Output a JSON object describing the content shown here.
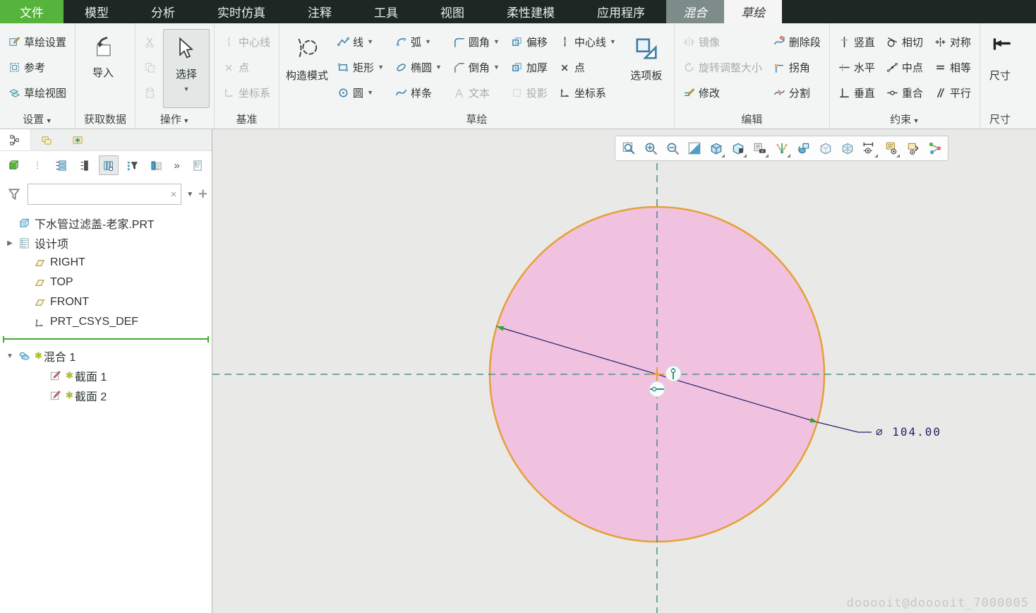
{
  "menu": {
    "tabs": [
      {
        "name": "file",
        "label": "文件",
        "style": "file"
      },
      {
        "name": "model",
        "label": "模型"
      },
      {
        "name": "analysis",
        "label": "分析"
      },
      {
        "name": "live-simulation",
        "label": "实时仿真"
      },
      {
        "name": "annotate",
        "label": "注释"
      },
      {
        "name": "tools",
        "label": "工具"
      },
      {
        "name": "view",
        "label": "视图"
      },
      {
        "name": "flexible-modeling",
        "label": "柔性建模"
      },
      {
        "name": "applications",
        "label": "应用程序"
      },
      {
        "name": "blend",
        "label": "混合",
        "style": "context"
      },
      {
        "name": "sketch",
        "label": "草绘",
        "style": "active"
      }
    ]
  },
  "ribbon": {
    "groups": [
      {
        "name": "setup",
        "label": "设置",
        "arrow": true,
        "layout": [
          {
            "type": "smallcol",
            "items": [
              {
                "name": "sketch-setup",
                "label": "草绘设置",
                "icon": "sketch-setup"
              },
              {
                "name": "references",
                "label": "参考",
                "icon": "references"
              },
              {
                "name": "sketch-view",
                "label": "草绘视图",
                "icon": "sketch-view"
              }
            ]
          }
        ]
      },
      {
        "name": "get-data",
        "label": "获取数据",
        "layout": [
          {
            "type": "big",
            "item": {
              "name": "import",
              "label": "导入",
              "icon": "import"
            }
          }
        ]
      },
      {
        "name": "operations",
        "label": "操作",
        "arrow": true,
        "layout": [
          {
            "type": "smallcol",
            "items": [
              {
                "name": "cut",
                "label": "",
                "icon": "cut",
                "disabled": true
              },
              {
                "name": "copy",
                "label": "",
                "icon": "copy",
                "disabled": true
              },
              {
                "name": "paste",
                "label": "",
                "icon": "paste",
                "disabled": true
              }
            ]
          },
          {
            "type": "big",
            "item": {
              "name": "select",
              "label": "选择",
              "icon": "select-cursor",
              "arrow": true,
              "selected": true
            }
          }
        ]
      },
      {
        "name": "datum",
        "label": "基准",
        "layout": [
          {
            "type": "smallcol",
            "items": [
              {
                "name": "datum-centerline",
                "label": "中心线",
                "icon": "datum-centerline",
                "disabled": true
              },
              {
                "name": "datum-point",
                "label": "点",
                "icon": "datum-point",
                "disabled": true
              },
              {
                "name": "datum-csys",
                "label": "坐标系",
                "icon": "datum-csys",
                "disabled": true
              }
            ]
          }
        ]
      },
      {
        "name": "sketching",
        "label": "草绘",
        "layout": [
          {
            "type": "big",
            "item": {
              "name": "construction-mode",
              "label": "构造模式",
              "icon": "construction-mode"
            }
          },
          {
            "type": "smallcol",
            "items": [
              {
                "name": "line",
                "label": "线",
                "icon": "line",
                "arrow": true
              },
              {
                "name": "rectangle",
                "label": "矩形",
                "icon": "rectangle",
                "arrow": true
              },
              {
                "name": "circle",
                "label": "圆",
                "icon": "circle",
                "arrow": true
              }
            ]
          },
          {
            "type": "smallcol",
            "items": [
              {
                "name": "arc",
                "label": "弧",
                "icon": "arc",
                "arrow": true
              },
              {
                "name": "ellipse",
                "label": "椭圆",
                "icon": "ellipse",
                "arrow": true
              },
              {
                "name": "spline",
                "label": "样条",
                "icon": "spline"
              }
            ]
          },
          {
            "type": "smallcol",
            "items": [
              {
                "name": "fillet",
                "label": "圆角",
                "icon": "fillet",
                "arrow": true
              },
              {
                "name": "chamfer",
                "label": "倒角",
                "icon": "chamfer",
                "arrow": true
              },
              {
                "name": "text",
                "label": "文本",
                "icon": "text",
                "disabled": true
              }
            ]
          },
          {
            "type": "smallcol",
            "items": [
              {
                "name": "offset",
                "label": "偏移",
                "icon": "offset"
              },
              {
                "name": "thicken",
                "label": "加厚",
                "icon": "thicken"
              },
              {
                "name": "project",
                "label": "投影",
                "icon": "project",
                "disabled": true
              }
            ]
          },
          {
            "type": "smallcol",
            "items": [
              {
                "name": "centerline",
                "label": "中心线",
                "icon": "centerline",
                "arrow": true
              },
              {
                "name": "point",
                "label": "点",
                "icon": "point"
              },
              {
                "name": "csys",
                "label": "坐标系",
                "icon": "csys"
              }
            ]
          },
          {
            "type": "big",
            "item": {
              "name": "palette",
              "label": "选项板",
              "icon": "palette"
            }
          }
        ]
      },
      {
        "name": "editing",
        "label": "编辑",
        "layout": [
          {
            "type": "smallcol",
            "items": [
              {
                "name": "mirror",
                "label": "镜像",
                "icon": "mirror",
                "disabled": true
              },
              {
                "name": "rotate-resize",
                "label": "旋转调整大小",
                "icon": "rotate-resize",
                "disabled": true
              },
              {
                "name": "modify",
                "label": "修改",
                "icon": "modify"
              }
            ]
          },
          {
            "type": "smallcol",
            "items": [
              {
                "name": "delete-segment",
                "label": "删除段",
                "icon": "delete-segment"
              },
              {
                "name": "corner",
                "label": "拐角",
                "icon": "corner"
              },
              {
                "name": "divide",
                "label": "分割",
                "icon": "divide"
              }
            ]
          }
        ]
      },
      {
        "name": "constrain",
        "label": "约束",
        "arrow": true,
        "layout": [
          {
            "type": "smallcol",
            "items": [
              {
                "name": "vertical-constraint",
                "label": "竖直",
                "icon": "vertical"
              },
              {
                "name": "horizontal-constraint",
                "label": "水平",
                "icon": "horizontal"
              },
              {
                "name": "perpendicular-constraint",
                "label": "垂直",
                "icon": "perpendicular"
              }
            ]
          },
          {
            "type": "smallcol",
            "items": [
              {
                "name": "tangent-constraint",
                "label": "相切",
                "icon": "tangent"
              },
              {
                "name": "midpoint-constraint",
                "label": "中点",
                "icon": "midpoint"
              },
              {
                "name": "coincident-constraint",
                "label": "重合",
                "icon": "coincident"
              }
            ]
          },
          {
            "type": "smallcol",
            "items": [
              {
                "name": "symmetric-constraint",
                "label": "对称",
                "icon": "symmetric"
              },
              {
                "name": "equal-constraint",
                "label": "相等",
                "icon": "equal"
              },
              {
                "name": "parallel-constraint",
                "label": "平行",
                "icon": "parallel"
              }
            ]
          }
        ]
      },
      {
        "name": "dimension",
        "label": "尺寸",
        "clipped": true,
        "layout": [
          {
            "type": "big",
            "item": {
              "name": "dimension",
              "label": "尺寸",
              "icon": "dimension"
            }
          }
        ]
      }
    ]
  },
  "panel": {
    "tabs": [
      {
        "name": "model-tree",
        "active": true
      },
      {
        "name": "folder-browser"
      },
      {
        "name": "favorites"
      }
    ],
    "toolbar": [
      {
        "name": "display-cube"
      },
      {
        "name": "drag-handle"
      },
      {
        "name": "expand-items"
      },
      {
        "name": "collapse-items"
      },
      {
        "name": "tree-columns",
        "pressed": true
      },
      {
        "name": "tree-filter"
      },
      {
        "name": "tree-copy"
      },
      {
        "name": "more-chevrons",
        "glyph": "»"
      },
      {
        "name": "settings-file"
      }
    ],
    "filter": {
      "value": "",
      "placeholder": "",
      "clear_glyph": "×"
    },
    "tree": {
      "items": [
        {
          "name": "part-node",
          "icon": "part",
          "label": "下水管过滤盖-老家.PRT",
          "indent": 0
        },
        {
          "name": "design-items-node",
          "icon": "design-items",
          "label": "设计项",
          "indent": 0,
          "expander": "collapsed"
        },
        {
          "name": "plane-right",
          "icon": "plane",
          "label": "RIGHT",
          "indent": 1
        },
        {
          "name": "plane-top",
          "icon": "plane",
          "label": "TOP",
          "indent": 1
        },
        {
          "name": "plane-front",
          "icon": "plane",
          "label": "FRONT",
          "indent": 1
        },
        {
          "name": "csys-node",
          "icon": "csys-tree",
          "label": "PRT_CSYS_DEF",
          "indent": 1
        },
        {
          "name": "insertion-marker",
          "type": "insertion"
        },
        {
          "name": "blend-feature",
          "icon": "blend",
          "label": "混合 1",
          "indent": 0,
          "expander": "expanded",
          "marker": "✱"
        },
        {
          "name": "section-1",
          "icon": "sketch-item",
          "label": "截面 1",
          "indent": 2,
          "marker": "✱"
        },
        {
          "name": "section-2",
          "icon": "sketch-item",
          "label": "截面 2",
          "indent": 2,
          "marker": "✱"
        }
      ]
    }
  },
  "canvas": {
    "toolbar": {
      "icons": [
        {
          "name": "zoom-region"
        },
        {
          "name": "zoom-in"
        },
        {
          "name": "zoom-out"
        },
        {
          "name": "refit"
        },
        {
          "name": "display-style",
          "corner": true
        },
        {
          "name": "section-view",
          "corner": true
        },
        {
          "name": "saved-orientations",
          "corner": true
        },
        {
          "name": "datum-display",
          "corner": true
        },
        {
          "name": "reorient-view"
        },
        {
          "name": "hidden-line-view"
        },
        {
          "name": "transparent-view"
        },
        {
          "name": "dimension-display",
          "corner": true
        },
        {
          "name": "annotation-display",
          "corner": true
        },
        {
          "name": "layer-display"
        },
        {
          "name": "spin-center"
        }
      ]
    },
    "sketch": {
      "dimension_label": "⌀ 104.00"
    },
    "watermark": "dooooit@dooooit_7000005"
  },
  "colors": {
    "accent_green": "#56b43c",
    "circle_fill": "#f0c2e0",
    "circle_stroke": "#e6a13c",
    "centerline": "#2c8577",
    "dimension": "#23236b",
    "arrow_green": "#2eaa2e"
  }
}
